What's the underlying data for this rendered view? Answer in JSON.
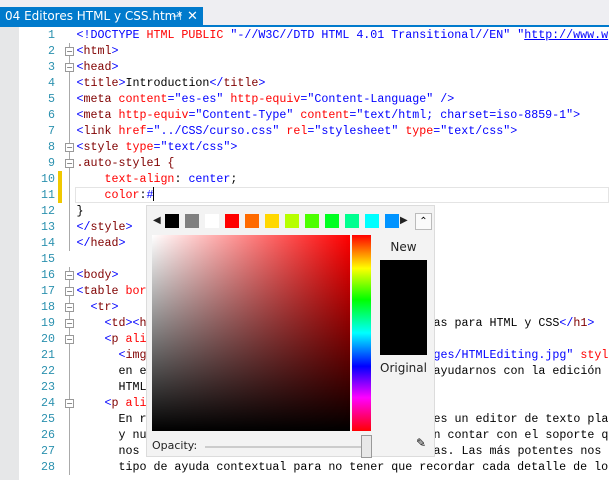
{
  "tab": {
    "title": "04 Editores HTML y CSS.htm*",
    "pin_icon": "⊣",
    "close_icon": "✕"
  },
  "editor": {
    "changed_lines": [
      10,
      11
    ],
    "current_line": 11,
    "lines": [
      {
        "n": "1",
        "seg": [
          [
            "<!DOCTYPE ",
            "t"
          ],
          [
            "HTML PUBLIC ",
            "a"
          ],
          [
            "\"-//W3C//DTD HTML 4.01 Transitional//EN\" ",
            "v"
          ],
          [
            "\"",
            "v"
          ],
          [
            "http://www.w",
            "u"
          ]
        ]
      },
      {
        "n": "2",
        "fold": true,
        "seg": [
          [
            "<",
            "t"
          ],
          [
            "html",
            "n"
          ],
          [
            ">",
            "t"
          ]
        ]
      },
      {
        "n": "3",
        "fold": true,
        "seg": [
          [
            "<",
            "t"
          ],
          [
            "head",
            "n"
          ],
          [
            ">",
            "t"
          ]
        ]
      },
      {
        "n": "4",
        "seg": [
          [
            "<",
            "t"
          ],
          [
            "title",
            "n"
          ],
          [
            ">",
            "t"
          ],
          [
            "Introduction",
            "x"
          ],
          [
            "</",
            "t"
          ],
          [
            "title",
            "n"
          ],
          [
            ">",
            "t"
          ]
        ]
      },
      {
        "n": "5",
        "seg": [
          [
            "<",
            "t"
          ],
          [
            "meta ",
            "n"
          ],
          [
            "content",
            "a"
          ],
          [
            "=\"es-es\" ",
            "v"
          ],
          [
            "http-equiv",
            "a"
          ],
          [
            "=\"Content-Language\" />",
            "v"
          ]
        ]
      },
      {
        "n": "6",
        "seg": [
          [
            "<",
            "t"
          ],
          [
            "meta ",
            "n"
          ],
          [
            "http-equiv",
            "a"
          ],
          [
            "=\"Content-Type\" ",
            "v"
          ],
          [
            "content",
            "a"
          ],
          [
            "=\"text/html; charset=iso-8859-1\">",
            "v"
          ]
        ]
      },
      {
        "n": "7",
        "seg": [
          [
            "<",
            "t"
          ],
          [
            "link ",
            "n"
          ],
          [
            "href",
            "a"
          ],
          [
            "=\"../CSS/curso.css\" ",
            "v"
          ],
          [
            "rel",
            "a"
          ],
          [
            "=\"stylesheet\" ",
            "v"
          ],
          [
            "type",
            "a"
          ],
          [
            "=\"text/css\">",
            "v"
          ]
        ]
      },
      {
        "n": "8",
        "fold": true,
        "seg": [
          [
            "<",
            "t"
          ],
          [
            "style ",
            "n"
          ],
          [
            "type",
            "a"
          ],
          [
            "=\"text/css\">",
            "v"
          ]
        ]
      },
      {
        "n": "9",
        "fold": true,
        "seg": [
          [
            ".auto-style1 {",
            "n"
          ]
        ]
      },
      {
        "n": "10",
        "seg": [
          [
            "    text-align",
            "a"
          ],
          [
            ": ",
            "x"
          ],
          [
            "center",
            "v"
          ],
          [
            ";",
            "x"
          ]
        ]
      },
      {
        "n": "11",
        "caret": true,
        "seg": [
          [
            "    color",
            "a"
          ],
          [
            ":",
            "x"
          ],
          [
            "#",
            "v"
          ]
        ]
      },
      {
        "n": "12",
        "seg": [
          [
            "}",
            "x"
          ]
        ]
      },
      {
        "n": "13",
        "seg": [
          [
            "</",
            "t"
          ],
          [
            "style",
            "n"
          ],
          [
            ">",
            "t"
          ]
        ]
      },
      {
        "n": "14",
        "seg": [
          [
            "</",
            "t"
          ],
          [
            "head",
            "n"
          ],
          [
            ">",
            "t"
          ]
        ]
      },
      {
        "n": "15",
        "seg": []
      },
      {
        "n": "16",
        "fold": true,
        "seg": [
          [
            "<",
            "t"
          ],
          [
            "body",
            "n"
          ],
          [
            ">",
            "t"
          ]
        ]
      },
      {
        "n": "17",
        "fold": true,
        "seg": [
          [
            "<",
            "t"
          ],
          [
            "table ",
            "n"
          ],
          [
            "bor",
            "a"
          ]
        ]
      },
      {
        "n": "18",
        "fold": true,
        "seg": [
          [
            "  <",
            "t"
          ],
          [
            "tr",
            "n"
          ],
          [
            ">",
            "t"
          ]
        ]
      },
      {
        "n": "19",
        "fold": true,
        "seg": [
          [
            "    <",
            "t"
          ],
          [
            "td",
            "n"
          ],
          [
            "><",
            "t"
          ],
          [
            "h",
            "n"
          ]
        ],
        "right": [
          [
            "as para HTML y CSS",
            "x"
          ],
          [
            "</",
            "t"
          ],
          [
            "h1",
            "n"
          ],
          [
            ">",
            "t"
          ]
        ]
      },
      {
        "n": "20",
        "fold": true,
        "seg": [
          [
            "    <",
            "t"
          ],
          [
            "p ",
            "n"
          ],
          [
            "ali",
            "a"
          ]
        ]
      },
      {
        "n": "21",
        "seg": [
          [
            "      <",
            "t"
          ],
          [
            "img",
            "n"
          ]
        ],
        "right": [
          [
            "ges/HTMLEditing.jpg\" ",
            "v"
          ],
          [
            "styl",
            "a"
          ]
        ]
      },
      {
        "n": "22",
        "seg": [
          [
            "      en e",
            "x"
          ]
        ],
        "right": [
          [
            "ayudarnos con la edición d",
            "x"
          ]
        ]
      },
      {
        "n": "23",
        "seg": [
          [
            "      HTML",
            "x"
          ]
        ]
      },
      {
        "n": "24",
        "fold": true,
        "seg": [
          [
            "    <",
            "t"
          ],
          [
            "p ",
            "n"
          ],
          [
            "ali",
            "a"
          ]
        ]
      },
      {
        "n": "25",
        "seg": [
          [
            "      En r",
            "x"
          ]
        ],
        "right": [
          [
            "es un editor de texto pla",
            "x"
          ]
        ]
      },
      {
        "n": "26",
        "seg": [
          [
            "      y nu",
            "x"
          ]
        ],
        "right": [
          [
            "n contar con el soporte q",
            "x"
          ]
        ]
      },
      {
        "n": "27",
        "seg": [
          [
            "      nos ",
            "x"
          ]
        ],
        "right": [
          [
            "as. Las más potentes nos d",
            "x"
          ]
        ]
      },
      {
        "n": "28",
        "seg": [
          [
            "      tipo de ayuda contextual para no tener que recordar cada detalle de lo",
            "x"
          ]
        ]
      }
    ]
  },
  "color_picker": {
    "swatches": [
      "#000000",
      "#808080",
      "#ffffff",
      "#ff0000",
      "#ff6a00",
      "#ffd800",
      "#b6ff00",
      "#4cff00",
      "#00ff21",
      "#00ff90",
      "#00ffff",
      "#0094ff"
    ],
    "prev_icon": "◀",
    "next_icon": "▶",
    "collapse_icon": "⌃",
    "new_label": "New",
    "original_label": "Original",
    "opacity_label": "Opacity:",
    "new_color": "#000000",
    "hue": "#ff0000",
    "opacity_percent": 100,
    "eyedropper_icon": "✎"
  }
}
